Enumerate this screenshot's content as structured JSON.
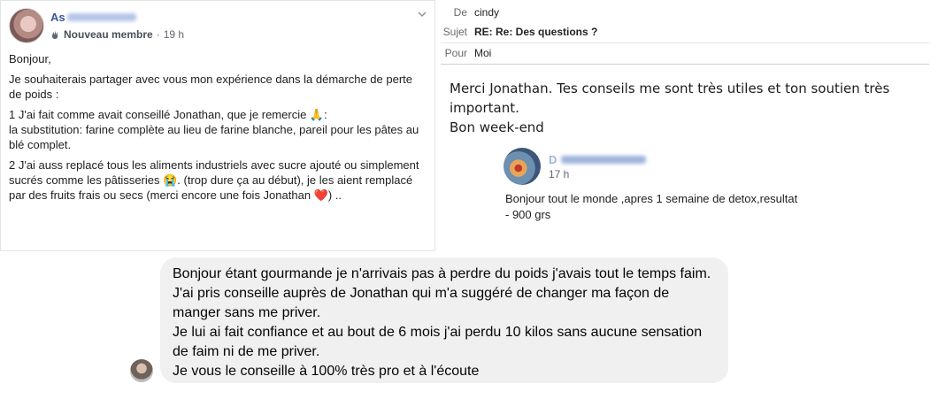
{
  "post": {
    "author_visible": "As",
    "badge": "Nouveau membre",
    "time": "19 h",
    "paragraphs": [
      "Bonjour,",
      "Je souhaiterais partager avec vous mon expérience dans la démarche de perte de poids :",
      "1 J'ai fait comme avait conseillé Jonathan, que je remercie 🙏:",
      "la substitution: farine complète au lieu de farine blanche, pareil pour les pâtes au blé complet.",
      "2 J'ai auss replacé tous les aliments industriels avec sucre ajouté ou simplement sucrés comme les pâtisseries 😭. (trop dure ça au début), je les aient remplacé par des fruits frais ou secs (merci encore une fois Jonathan ❤️) .."
    ]
  },
  "email": {
    "from_label": "De",
    "from_value": "cindy",
    "subject_label": "Sujet",
    "subject_value": "RE: Re: Des questions ?",
    "to_label": "Pour",
    "to_value": "Moi",
    "body_line1": "Merci Jonathan. Tes conseils me sont très utiles et ton soutien très important.",
    "body_line2": "Bon week-end"
  },
  "quote": {
    "author_visible": "D",
    "time": "17 h",
    "text_line1": "Bonjour tout le monde ,apres 1 semaine de detox,resultat",
    "text_line2": "- 900 grs"
  },
  "chat": {
    "lines": [
      "Bonjour étant gourmande je n'arrivais pas à perdre du poids j'avais tout le temps faim.",
      "J'ai pris conseille auprès de Jonathan qui m'a suggéré de changer ma façon de",
      "manger sans me priver.",
      "Je lui ai fait confiance et au bout de 6 mois j'ai perdu 10 kilos sans aucune sensation",
      "de faim ni de me priver.",
      "Je vous le conseille à 100% très pro et à l'écoute"
    ]
  }
}
